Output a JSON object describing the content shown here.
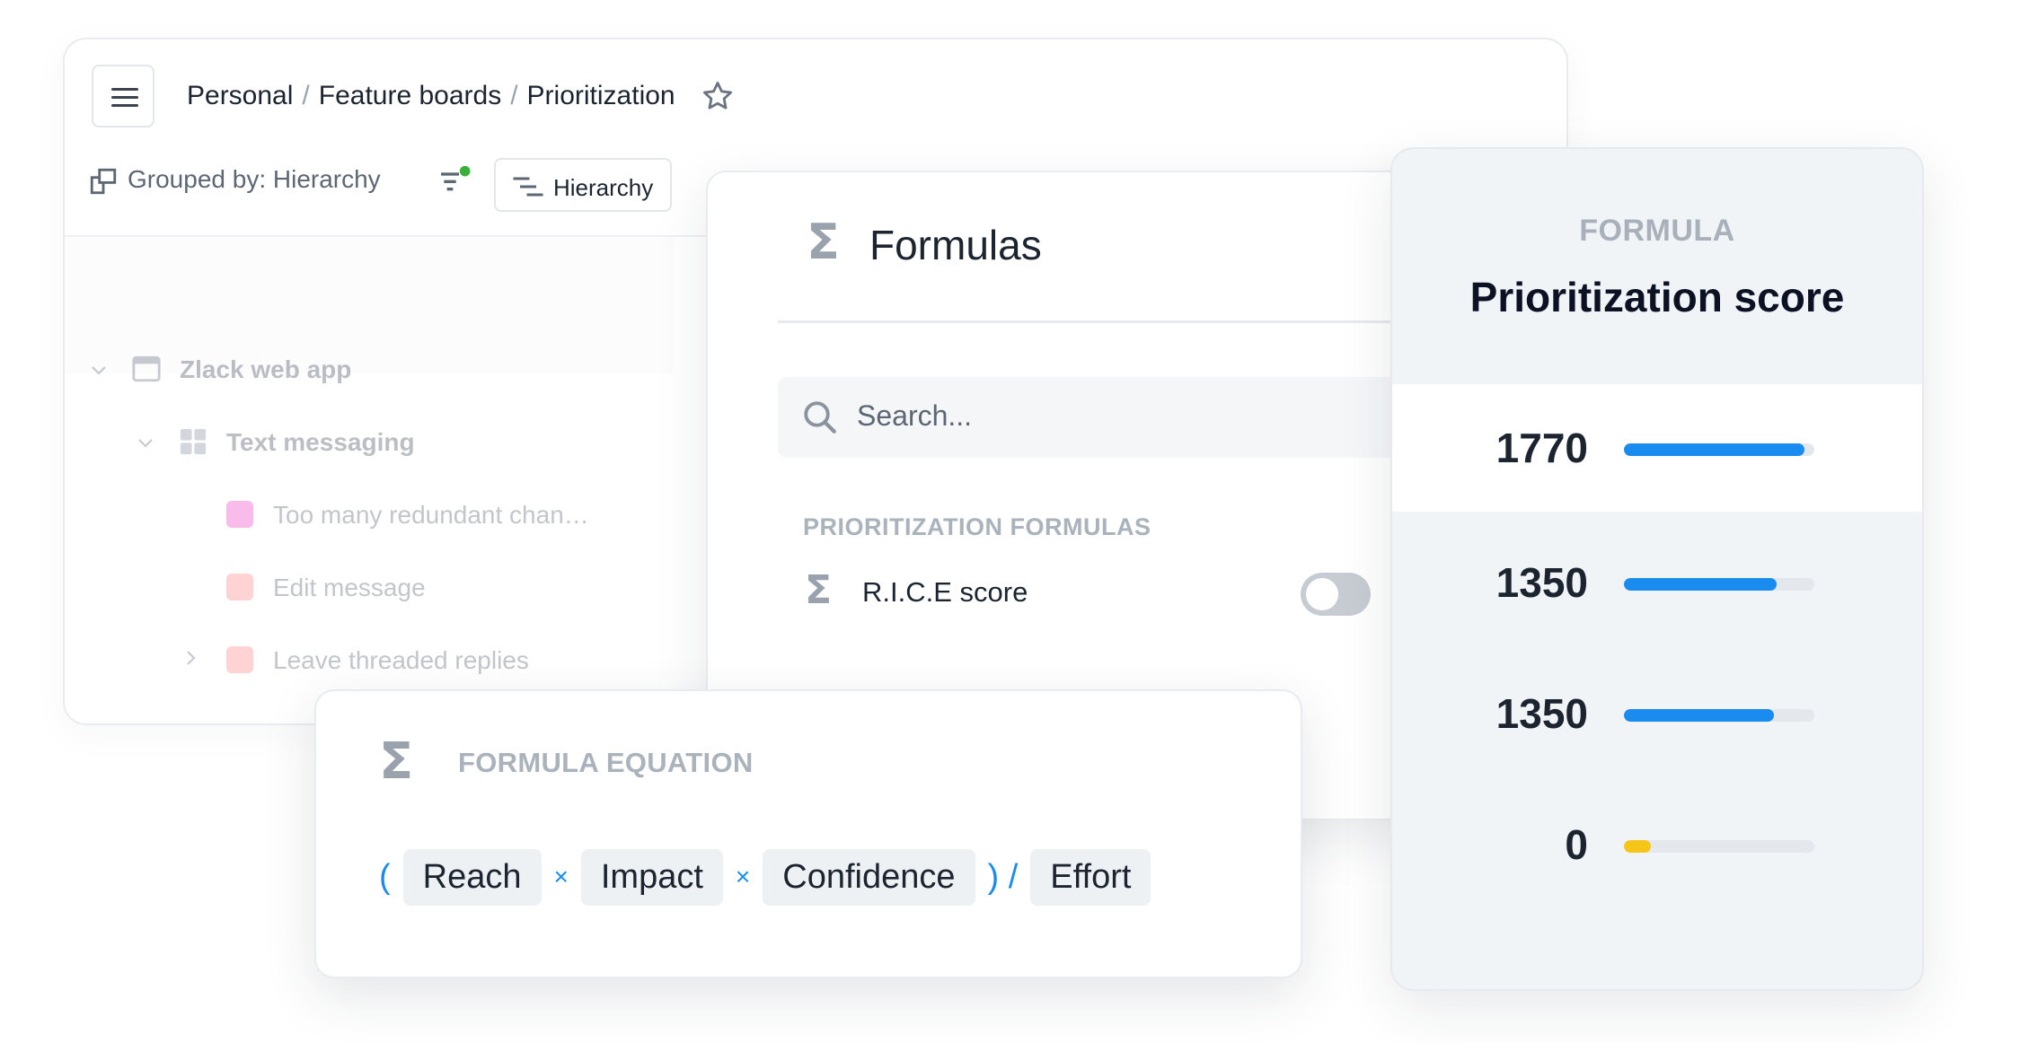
{
  "breadcrumb": {
    "items": [
      "Personal",
      "Feature boards",
      "Prioritization"
    ]
  },
  "toolbar": {
    "grouped_label": "Grouped by: Hierarchy",
    "hierarchy_button": "Hierarchy"
  },
  "tree": {
    "items": [
      {
        "label": "Zlack web app"
      },
      {
        "label": "Text messaging"
      },
      {
        "label": "Too many redundant chan…",
        "color": "#ee4dc7"
      },
      {
        "label": "Edit message",
        "color": "#ff8a8a"
      },
      {
        "label": "Leave threaded replies",
        "color": "#ff8a8a"
      }
    ]
  },
  "formulas": {
    "title": "Formulas",
    "search_placeholder": "Search...",
    "section_label": "PRIORITIZATION FORMULAS",
    "items": [
      {
        "label": "R.I.C.E score",
        "enabled": false
      }
    ]
  },
  "equation": {
    "title": "FORMULA EQUATION",
    "open_paren": "(",
    "close_paren_div": ") /",
    "times": "×",
    "tokens": [
      "Reach",
      "Impact",
      "Confidence",
      "Effort"
    ]
  },
  "score": {
    "eyebrow": "FORMULA",
    "title": "Prioritization score",
    "rows": [
      {
        "value": "1770",
        "fraction": 0.95,
        "color": "#1a8cf0"
      },
      {
        "value": "1350",
        "fraction": 0.8,
        "color": "#1a8cf0"
      },
      {
        "value": "1350",
        "fraction": 0.79,
        "color": "#1a8cf0"
      },
      {
        "value": "0",
        "fraction": 0.14,
        "color": "#f5c518"
      }
    ]
  }
}
